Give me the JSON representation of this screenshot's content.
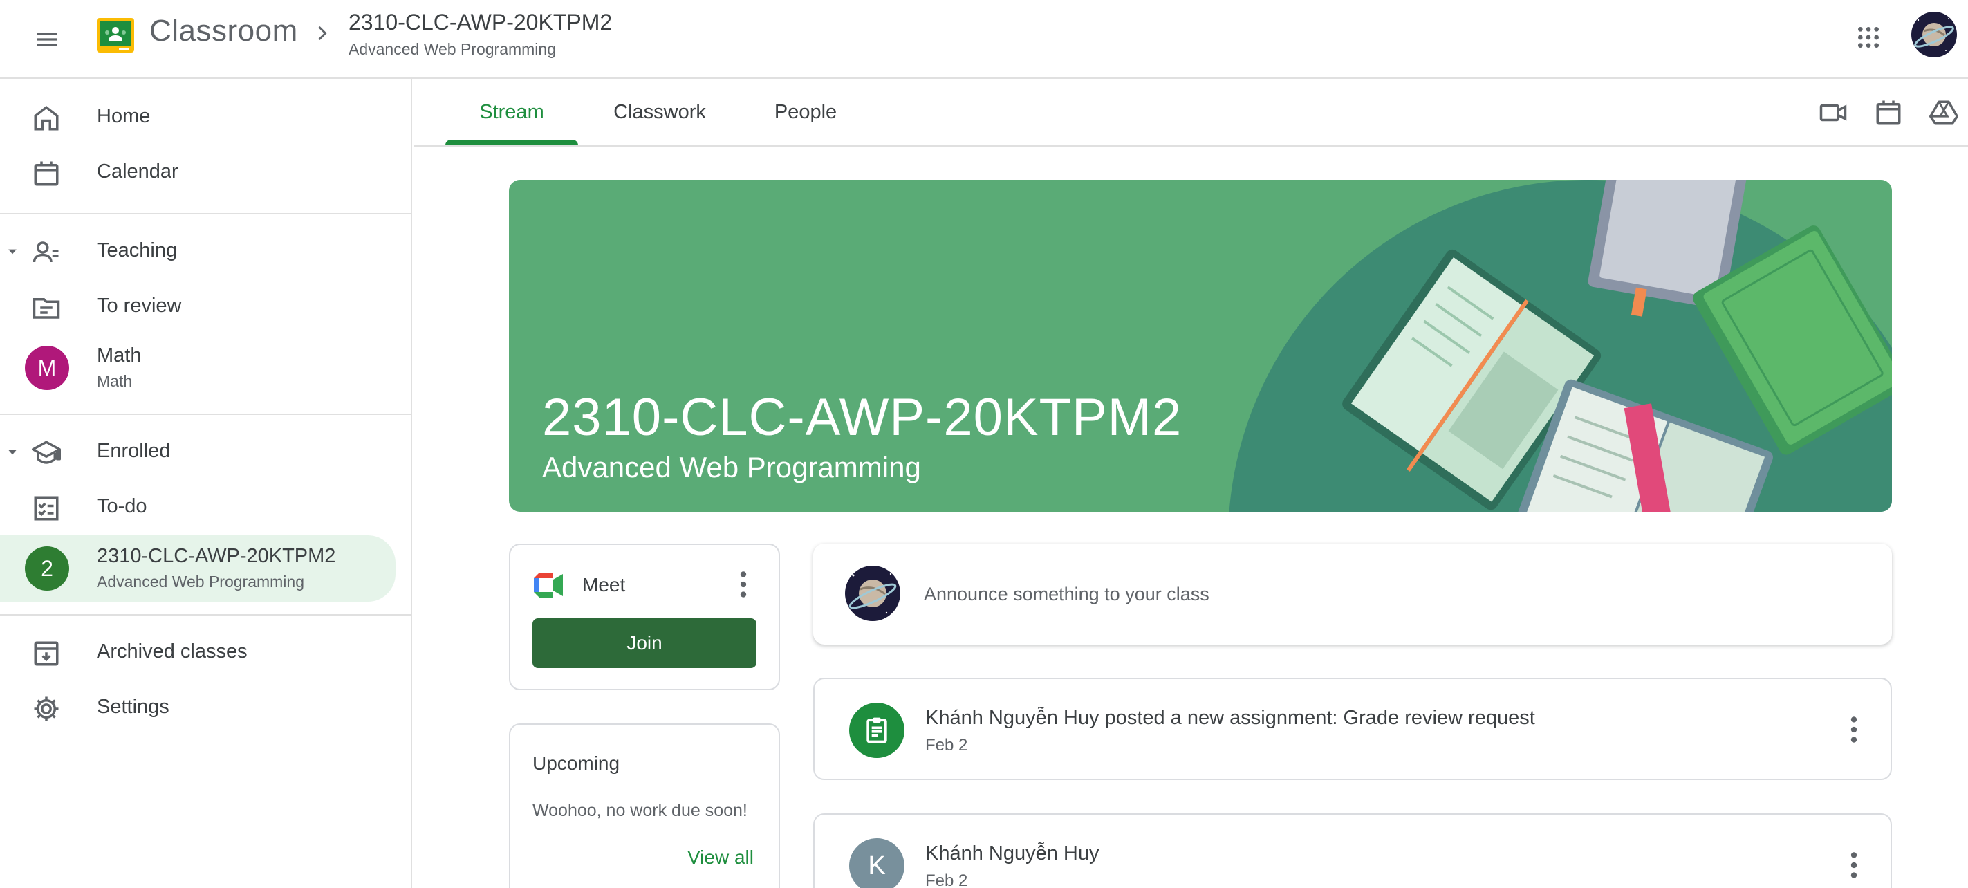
{
  "header": {
    "menu_icon": "hamburger-menu-icon",
    "app_title": "Classroom",
    "breadcrumb_title": "2310-CLC-AWP-20KTPM2",
    "breadcrumb_subtitle": "Advanced Web Programming",
    "apps_icon": "google-apps-icon",
    "brand_yellow": "#fbbc04",
    "brand_green": "#1e8e3e"
  },
  "sidebar": {
    "home": "Home",
    "calendar": "Calendar",
    "teaching": "Teaching",
    "to_review": "To review",
    "math_avatar": "M",
    "math_title": "Math",
    "math_subtitle": "Math",
    "enrolled": "Enrolled",
    "todo": "To-do",
    "class_avatar": "2",
    "class_title": "2310-CLC-AWP-20KTPM2",
    "class_subtitle": "Advanced Web Programming",
    "archived": "Archived classes",
    "settings": "Settings"
  },
  "tabs": {
    "stream": "Stream",
    "classwork": "Classwork",
    "people": "People",
    "active": "Stream"
  },
  "banner": {
    "title": "2310-CLC-AWP-20KTPM2",
    "subtitle": "Advanced Web Programming",
    "color": "#5aab76"
  },
  "meet": {
    "label": "Meet",
    "join": "Join"
  },
  "upcoming": {
    "title": "Upcoming",
    "empty": "Woohoo, no work due soon!",
    "view_all": "View all"
  },
  "announce": {
    "placeholder": "Announce something to your class"
  },
  "posts": [
    {
      "title": "Khánh Nguyễn Huy posted a new assignment: Grade review request",
      "date": "Feb 2",
      "icon": "assignment-icon"
    },
    {
      "avatar": "K",
      "title": "Khánh Nguyễn Huy",
      "date": "Feb 2"
    }
  ]
}
